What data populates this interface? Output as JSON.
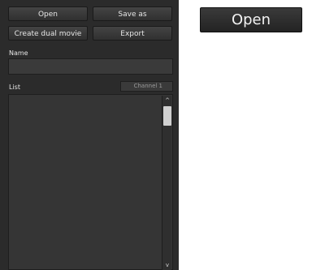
{
  "buttons": {
    "open": "Open",
    "save_as": "Save as",
    "create_dual_movie": "Create dual movie",
    "export": "Export"
  },
  "fields": {
    "name_label": "Name",
    "name_value": "",
    "list_label": "List",
    "channel_selected": "Channel 1"
  },
  "list": {
    "items": []
  },
  "icons": {
    "scroll_up": "scroll-up-arrow-icon",
    "scroll_down": "scroll-down-arrow-icon"
  },
  "preview": {
    "open_label": "Open"
  },
  "colors": {
    "panel_bg": "#2b2b2b",
    "button_bg": "#3a3a3a",
    "text": "#e6e6e6",
    "thumb": "#d0d0d0"
  }
}
